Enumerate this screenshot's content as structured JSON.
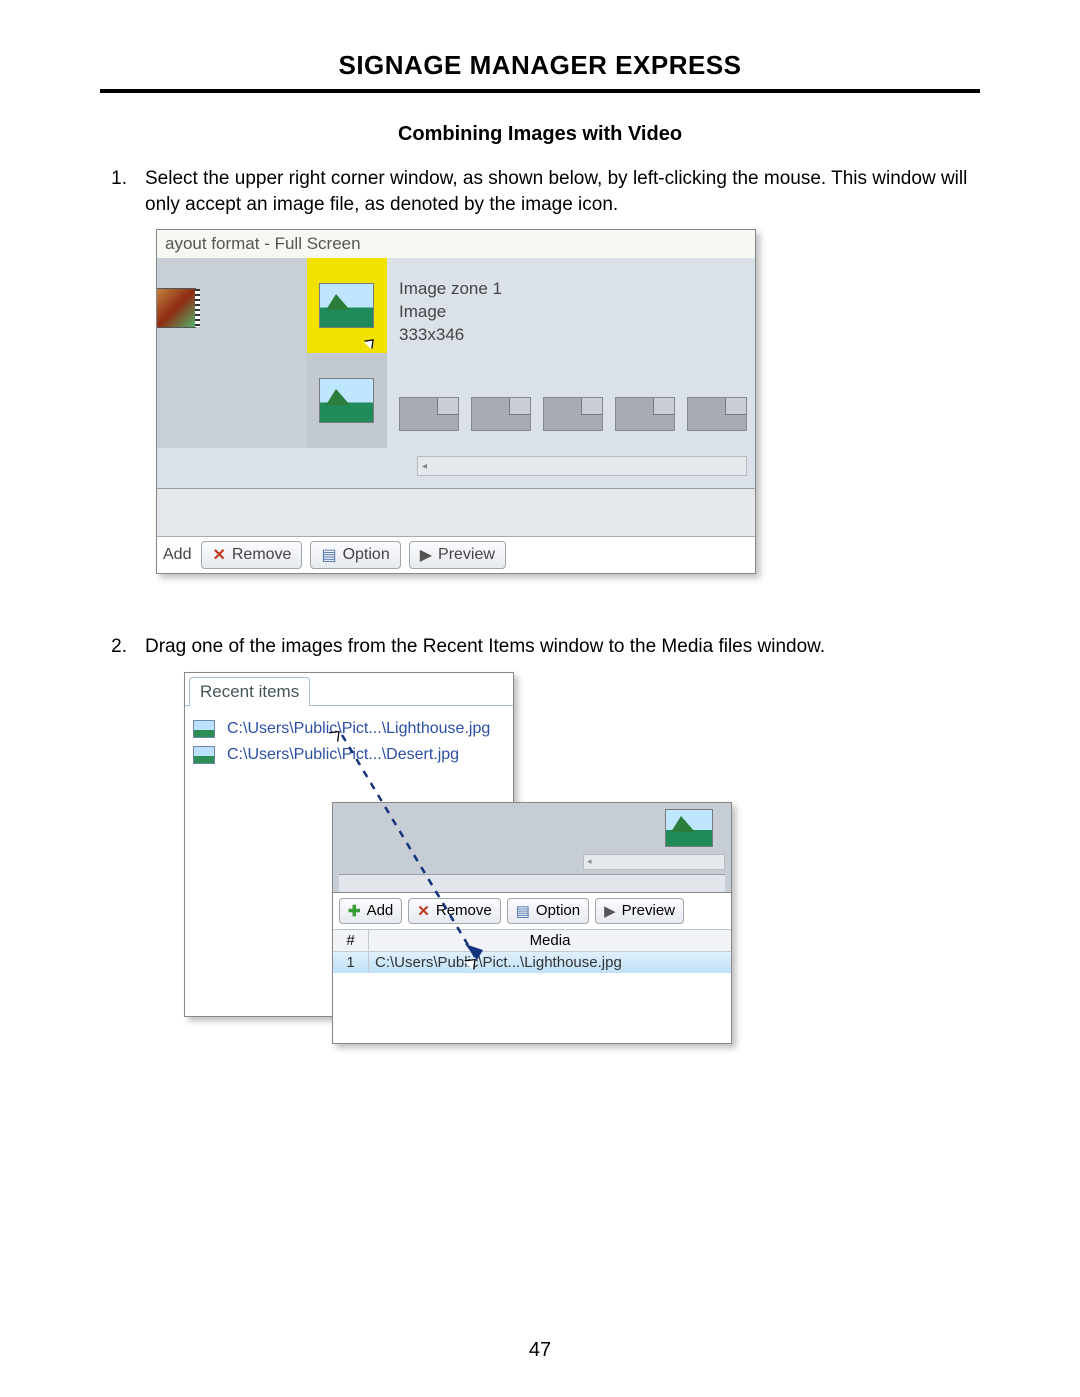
{
  "header_title": "SIGNAGE MANAGER EXPRESS",
  "section_title": "Combining Images with Video",
  "steps": [
    {
      "num": "1.",
      "text": "Select the upper right corner window, as shown below, by left-clicking the mouse.  This window will only accept an image file, as denoted by the image icon."
    },
    {
      "num": "2.",
      "text": "Drag one of the images from the Recent Items window to the Media files window."
    }
  ],
  "page_number": "47",
  "screenshot1": {
    "title_fragment": "ayout format - Full Screen",
    "zone_info": {
      "line1": "Image zone 1",
      "line2": "Image",
      "line3": "333x346"
    },
    "toolbar": {
      "add": "Add",
      "remove": "Remove",
      "option": "Option",
      "preview": "Preview"
    }
  },
  "screenshot2": {
    "tab_label": "Recent items",
    "recent_items": [
      "C:\\Users\\Public\\Pict...\\Lighthouse.jpg",
      "C:\\Users\\Public\\Pict...\\Desert.jpg"
    ],
    "toolbar": {
      "add": "Add",
      "remove": "Remove",
      "option": "Option",
      "preview": "Preview"
    },
    "table": {
      "col1": "#",
      "col2": "Media",
      "row_num": "1",
      "row_media": "C:\\Users\\Public\\Pict...\\Lighthouse.jpg"
    }
  }
}
